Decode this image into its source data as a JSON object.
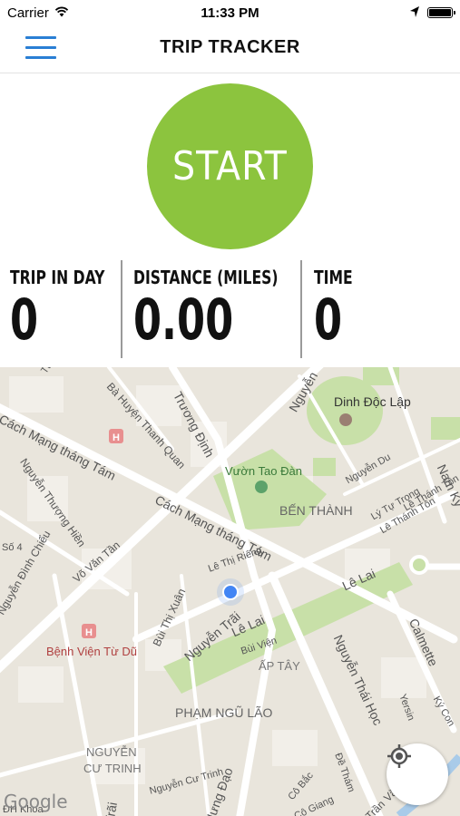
{
  "status_bar": {
    "carrier": "Carrier",
    "time": "11:33 PM"
  },
  "header": {
    "title": "TRIP TRACKER",
    "menu_icon": "hamburger-menu-icon"
  },
  "start_button": {
    "label": "START",
    "color": "#8cc43e"
  },
  "stats": [
    {
      "label": "TRIP IN DAY",
      "value": "0"
    },
    {
      "label": "DISTANCE (MILES)",
      "value": "0.00"
    },
    {
      "label": "TIME",
      "value": "0"
    }
  ],
  "map": {
    "attribution": "Google",
    "labels": {
      "dinh_doc_lap": "Dinh Độc Lập",
      "vuon_tao_dan": "Vườn Tao Đàn",
      "ben_thanh": "BẾN THÀNH",
      "cach_mang_1": "Cách Mạng tháng Tám",
      "cach_mang_2": "Cách Mạng tháng Tám",
      "truong_dinh": "Trương Định",
      "ba_huyen": "Bà Huyện Thanh Quan",
      "nguyen_thuong_hien": "Nguyễn Thượng Hiền",
      "vo_van_tan": "Võ Văn Tần",
      "nguyen_dinh_chieu": "Nguyễn Đình Chiểu",
      "le_thi_rieng": "Lê Thị Riêng",
      "bui_thi_xuan": "Bùi Thị Xuân",
      "nguyen_trai": "Nguyễn Trãi",
      "le_lai_1": "Lê Lai",
      "le_lai_2": "Lê Lai",
      "bui_vien": "Bùi Viện",
      "ap_tay": "ẤP TÂY",
      "nguyen_thai_hoc": "Nguyễn Thái Học",
      "calmette": "Calmette",
      "pham_ngu_lao": "PHẠM NGŨ LÃO",
      "benh_vien": "Bệnh Viện Từ Dũ",
      "nguyen_cu_trinh_area": "NGUYỄN",
      "cu_trinh": "CƯ TRINH",
      "nguyen_cu_trinh": "Nguyễn Cư Trinh",
      "hung_dao": "Hưng Đạo",
      "nguyen_du": "Nguyễn Du",
      "ly_tu_trong": "Lý Tự Trọng",
      "le_thanh_ton_1": "Lê Thánh Tôn",
      "le_thanh_ton_2": "Lê Thánh Tôn",
      "nam_ky": "Nam Kỳ",
      "nguyen_top": "Nguyễn",
      "co_bac": "Cô Bắc",
      "de_tham": "Đề Thám",
      "co_giang": "Cô Giang",
      "yersin": "Yersin",
      "ky_con": "Ký Con",
      "tu_xuong": "Tú Xương",
      "dh_khoa": "ĐH Khoa",
      "so_4": "Số 4",
      "tran": "Trần",
      "van": "Văn",
      "trai_bottom": "Trãi"
    }
  }
}
